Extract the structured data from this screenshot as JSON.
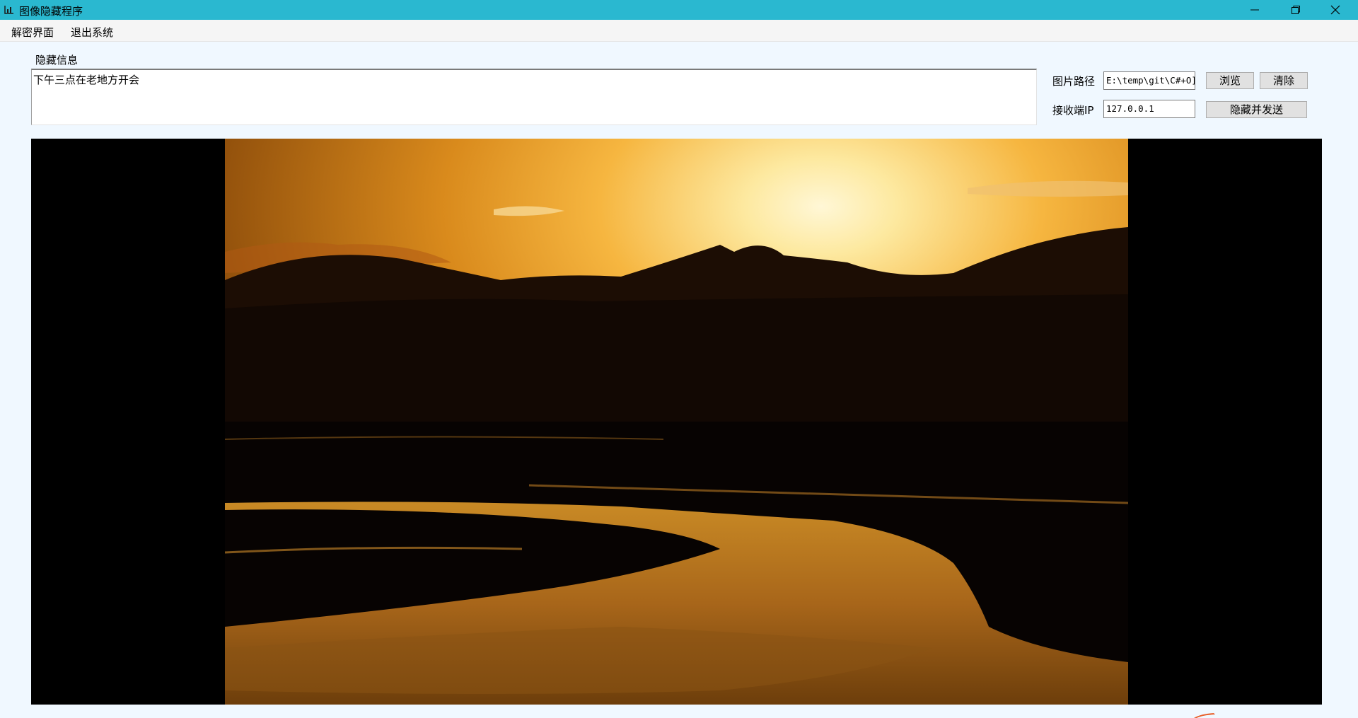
{
  "window": {
    "title": "图像隐藏程序",
    "title_bar_color": "#2ab8d0",
    "icon": "chart-app-icon",
    "controls": [
      "minimize-icon",
      "restore-icon",
      "close-icon"
    ]
  },
  "menu": {
    "items": [
      "解密界面",
      "退出系统"
    ]
  },
  "hidden_info": {
    "label": "隐藏信息",
    "value": "下午三点在老地方开会"
  },
  "image_path": {
    "label": "图片路径",
    "value": "E:\\temp\\git\\C#+O]",
    "browse_button": "浏览",
    "clear_button": "清除"
  },
  "receiver_ip": {
    "label": "接收端IP",
    "value": "127.0.0.1",
    "send_button": "隐藏并发送"
  },
  "preview": {
    "background_color": "#000000",
    "image_description": "sunset-mountains-river-photo"
  }
}
